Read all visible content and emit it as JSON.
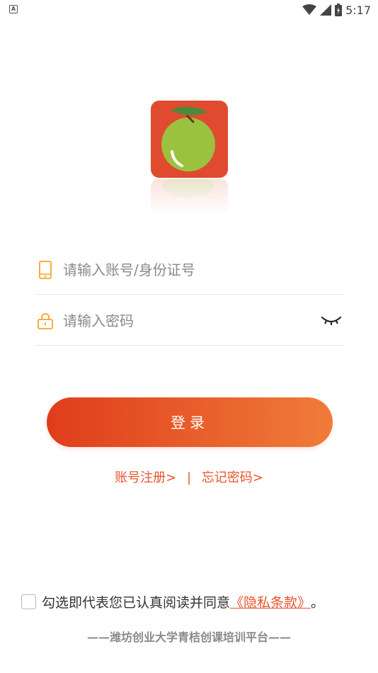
{
  "status_bar": {
    "notification_icon": "A",
    "time": "5:17",
    "icons": [
      "wifi-icon",
      "cell-signal-icon",
      "battery-icon"
    ]
  },
  "logo": {
    "name": "app-logo",
    "bg": "#e04b2f",
    "fruit": "#9bc23f",
    "leaf": "#4a8a3a"
  },
  "form": {
    "account_placeholder": "请输入账号/身份证号",
    "password_placeholder": "请输入密码",
    "icon_color": "#f5a623"
  },
  "login_button": {
    "label": "登录"
  },
  "links": {
    "register": "账号注册>",
    "separator": "|",
    "forgot": "忘记密码>"
  },
  "agreement": {
    "text": "勾选即代表您已认真阅读并同意",
    "policy": "《隐私条款》",
    "period": "。"
  },
  "footer": {
    "text": "——潍坊创业大学青桔创课培训平台——"
  },
  "colors": {
    "accent": "#e8542c",
    "gradient_start": "#e03d1a",
    "gradient_end": "#ef7c3a"
  }
}
